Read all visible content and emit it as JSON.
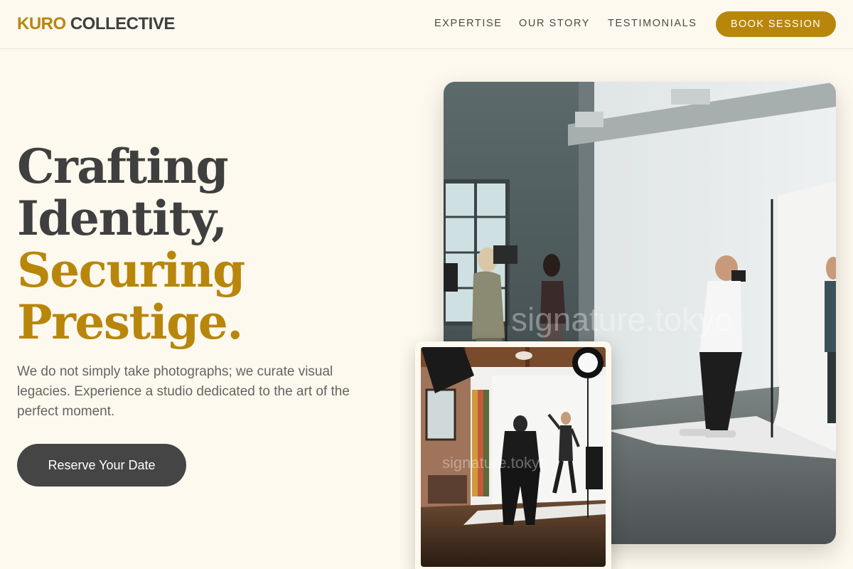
{
  "brand": {
    "part1": "KURO",
    "part2": "COLLECTIVE",
    "accent": "#b8860b",
    "dark": "#3f3f3f"
  },
  "nav": {
    "links": [
      "EXPERTISE",
      "OUR STORY",
      "TESTIMONIALS"
    ],
    "cta": "BOOK SESSION"
  },
  "hero": {
    "line1": "Crafting",
    "line2": "Identity,",
    "line3": "Securing",
    "line4": "Prestige.",
    "subtitle": "We do not simply take photographs; we curate visual legacies. Experience a studio dedicated to the art of the perfect moment.",
    "cta": "Reserve Your Date"
  },
  "images": {
    "main_watermark": "signature.tokyo",
    "secondary_watermark": "signature.tokyo"
  },
  "colors": {
    "background": "#fdf9ee",
    "cta_dark": "#454545"
  }
}
